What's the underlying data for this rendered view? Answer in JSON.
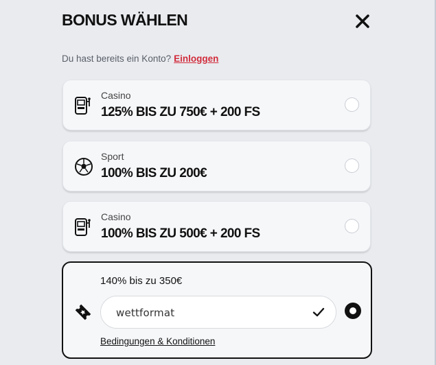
{
  "header": {
    "title": "BONUS WÄHLEN",
    "close_icon": "close-icon"
  },
  "account": {
    "prompt": "Du hast bereits ein Konto?",
    "login_link": "Einloggen"
  },
  "bonuses": [
    {
      "category": "Casino",
      "offer": "125% BIS ZU 750€ + 200 FS",
      "icon": "slot-machine-icon",
      "selected": false
    },
    {
      "category": "Sport",
      "offer": "100% BIS ZU 200€",
      "icon": "soccer-ball-icon",
      "selected": false
    },
    {
      "category": "Casino",
      "offer": "100% BIS ZU 500€ + 200 FS",
      "icon": "slot-machine-icon",
      "selected": false
    }
  ],
  "promo": {
    "title": "140% bis zu 350€",
    "code_value": "wettformat",
    "icon": "ticket-icon",
    "terms_link": "Bedingungen & Konditionen",
    "selected": true
  },
  "colors": {
    "accent_link": "#d22c3b",
    "background": "#e9ebef",
    "card": "#f6f7f9"
  }
}
